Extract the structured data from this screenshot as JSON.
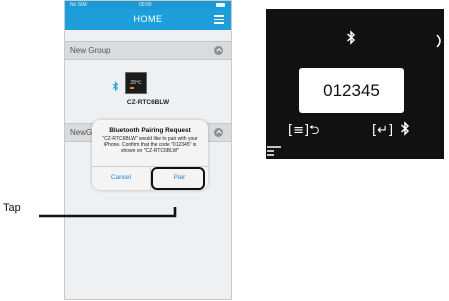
{
  "phone": {
    "status": {
      "carrier": "No SIM",
      "time": "00:00"
    },
    "header": {
      "title": "HOME",
      "menu_icon": "hamburger-icon"
    },
    "groups": [
      {
        "label": "New Group"
      },
      {
        "label": "NewG"
      }
    ],
    "device": {
      "name": "CZ-RTC6BLW",
      "screen_text": "28℃"
    },
    "dialog": {
      "title": "Bluetooth Pairing Request",
      "message": "\"CZ-RTC6BLW\" would like to pair with your iPhone. Confirm that the code \"012345\" is shown on \"CZ-RTC6BLW\"",
      "cancel_label": "Cancel",
      "pair_label": "Pair"
    }
  },
  "callout": {
    "label": "Tap"
  },
  "thermostat": {
    "pairing_code": "012345",
    "left_button_label": "[≡]⮌",
    "right_button_label": "[↵]"
  },
  "colors": {
    "accent": "#1e9fdb",
    "link": "#1a86d9"
  }
}
